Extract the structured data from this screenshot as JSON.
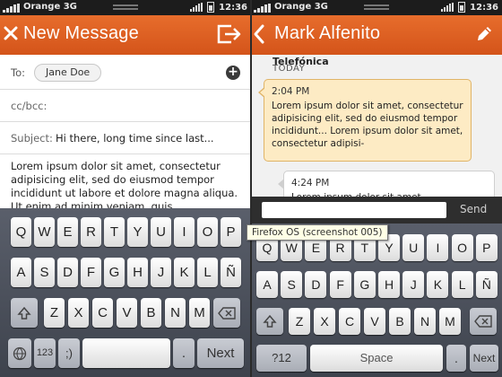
{
  "status": {
    "carrier": "Orange 3G",
    "time": "12:36"
  },
  "compose": {
    "title": "New Message",
    "to_label": "To:",
    "recipient": "Jane Doe",
    "cc_label": "cc/bcc:",
    "subject_label": "Subject:",
    "subject_value": "Hi there, long time since last...",
    "body": "Lorem ipsum dolor sit amet, consectetur adipisicing elit, sed do eiusmod tempor incididunt ut labore et dolore magna aliqua. Ut enim ad minim veniam, quis"
  },
  "keyboard_left": {
    "row1": [
      "Q",
      "W",
      "E",
      "R",
      "T",
      "Y",
      "U",
      "I",
      "O",
      "P"
    ],
    "row2": [
      "A",
      "S",
      "D",
      "F",
      "G",
      "H",
      "J",
      "K",
      "L",
      "Ñ"
    ],
    "row3": [
      "Z",
      "X",
      "C",
      "V",
      "B",
      "N",
      "M"
    ],
    "numkey": "123",
    "punct": ";)",
    "dot": ".",
    "next": "Next"
  },
  "conversation": {
    "contact": "Mark Alfenito",
    "sender_label": "Telefónica",
    "today_label": "TODAY",
    "messages": [
      {
        "time": "2:04 PM",
        "text": "Lorem ipsum dolor sit amet, consectetur adipisicing elit, sed do eiusmod tempor incididunt... Lorem ipsum dolor sit amet, consectetur adipisi-"
      },
      {
        "time": "4:24 PM",
        "text": "Lorem ipsum dolor sit amet,"
      }
    ],
    "send_label": "Send"
  },
  "keyboard_right": {
    "row1": [
      "Q",
      "W",
      "E",
      "R",
      "T",
      "Y",
      "U",
      "I",
      "O",
      "P"
    ],
    "row2": [
      "A",
      "S",
      "D",
      "F",
      "G",
      "H",
      "J",
      "K",
      "L",
      "Ñ"
    ],
    "row3": [
      "Z",
      "X",
      "C",
      "V",
      "B",
      "N",
      "M"
    ],
    "numkey": "?12",
    "space": "Space",
    "dot": ".",
    "next": "Next"
  },
  "tooltip": "Firefox OS (screenshot 005)",
  "colors": {
    "header": "#e0601f",
    "bubble_in": "#fdebc4",
    "keyboard": "#4a4f59"
  },
  "icons": {
    "close": "close-icon",
    "send": "send-icon",
    "back": "back-chevron-icon",
    "edit": "pencil-icon",
    "add": "add-contact-icon",
    "shift": "shift-icon",
    "backspace": "backspace-icon",
    "globe": "globe-icon"
  }
}
